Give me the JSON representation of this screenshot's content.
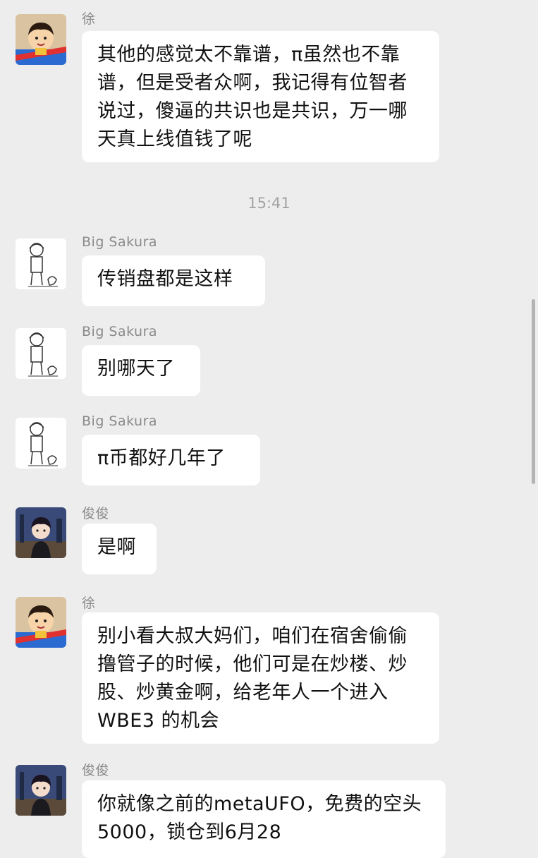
{
  "messages": [
    {
      "sender": "徐",
      "text": "其他的感觉太不靠谱，π虽然也不靠谱，但是受者众啊，我记得有位智者说过，傻逼的共识也是共识，万一哪天真上线值钱了呢",
      "avatar": "cartoon-boy-avatar"
    },
    {
      "sender": "Big  Sakura",
      "text": "传销盘都是这样",
      "avatar": "sketch-avatar"
    },
    {
      "sender": "Big  Sakura",
      "text": "别哪天了",
      "avatar": "sketch-avatar"
    },
    {
      "sender": "Big  Sakura",
      "text": "π币都好几年了",
      "avatar": "sketch-avatar"
    },
    {
      "sender": "俊俊",
      "text": "是啊",
      "avatar": "anime-avatar"
    },
    {
      "sender": "徐",
      "text": "别小看大叔大妈们，咱们在宿舍偷偷撸管子的时候，他们可是在炒楼、炒股、炒黄金啊，给老年人一个进入 WBE3 的机会",
      "avatar": "cartoon-boy-avatar"
    },
    {
      "sender": "俊俊",
      "text": "你就像之前的metaUFO，免费的空头 5000，锁仓到6月28",
      "avatar": "anime-avatar"
    }
  ],
  "timestamp": "15:41",
  "colors": {
    "background": "#ededed",
    "bubble": "#ffffff",
    "sender": "#8a8a8a",
    "timestamp": "#a3a3a3"
  }
}
